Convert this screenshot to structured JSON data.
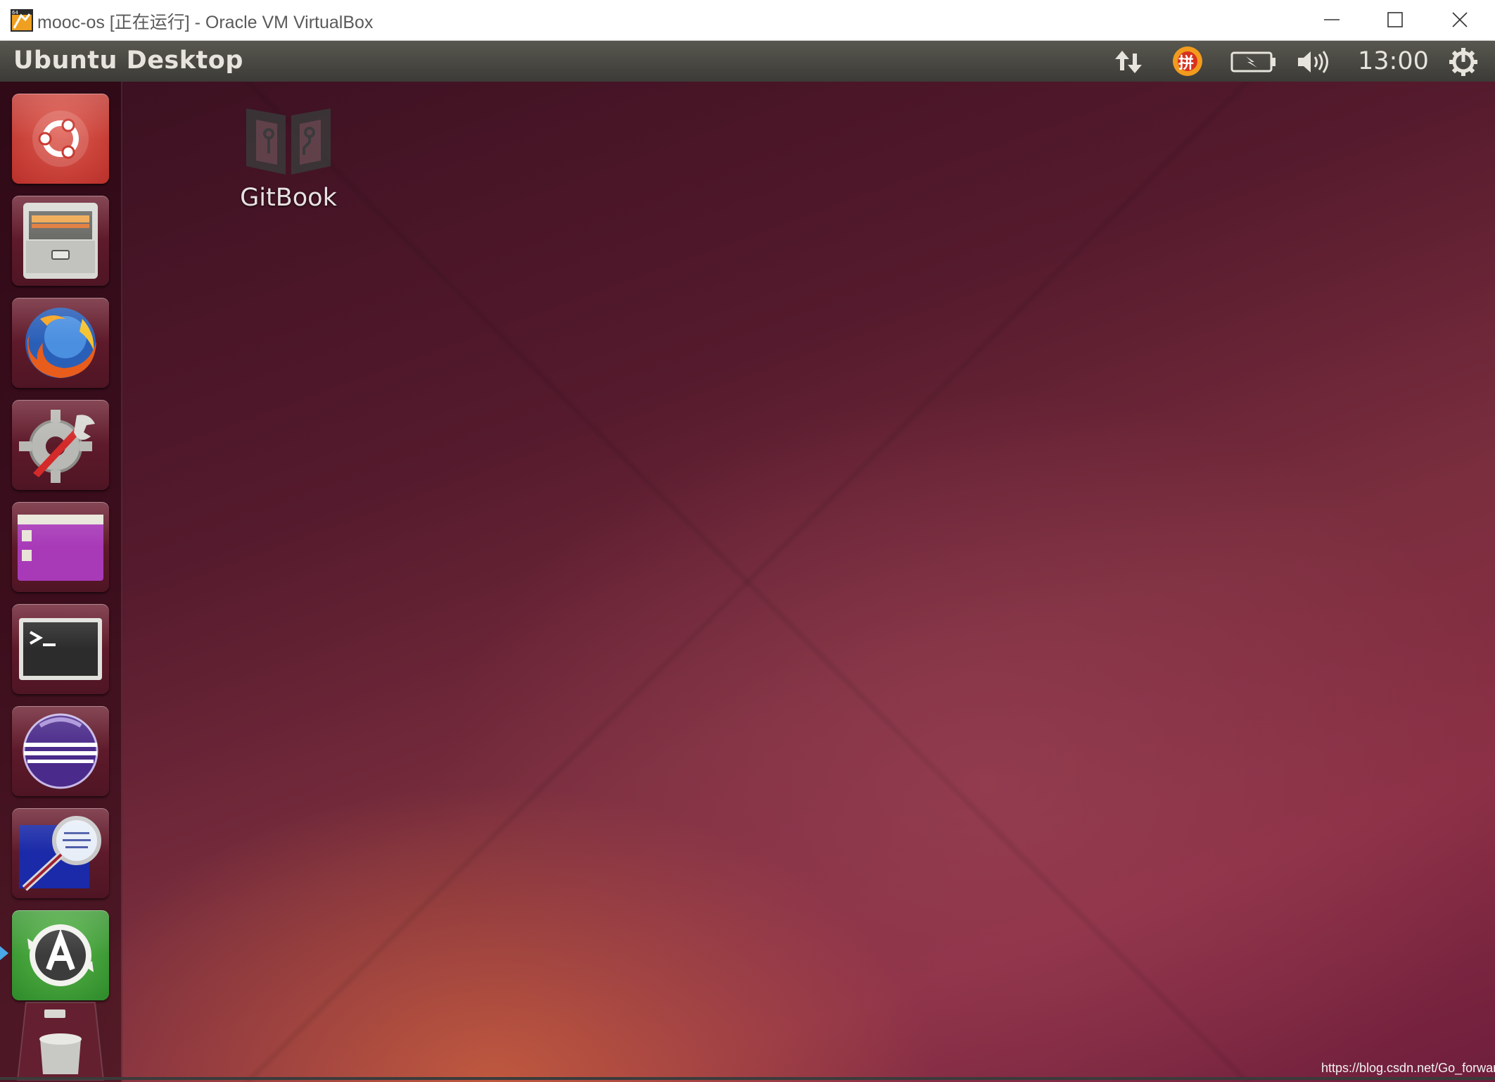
{
  "host_window": {
    "title": "mooc-os [正在运行] - Oracle VM VirtualBox",
    "controls": [
      "minimize",
      "maximize",
      "close"
    ]
  },
  "top_panel": {
    "title": "Ubuntu Desktop",
    "indicators": [
      "network-updown-icon",
      "input-method-pinyin-icon",
      "battery-icon",
      "volume-icon"
    ],
    "input_method_label": "拼",
    "clock": "13:00",
    "session_icon": "power-gear-icon"
  },
  "desktop": {
    "icons": [
      {
        "label": "GitBook",
        "icon": "gitbook-icon"
      }
    ]
  },
  "launcher": {
    "items": [
      {
        "name": "dash-home",
        "icon": "ubuntu-logo-icon",
        "color": "#c8443c"
      },
      {
        "name": "files",
        "icon": "file-cabinet-icon",
        "color": "#8a8a86"
      },
      {
        "name": "firefox",
        "icon": "firefox-icon",
        "color": "#7a2a3a"
      },
      {
        "name": "system-settings",
        "icon": "gear-wrench-icon",
        "color": "#7a2a3a"
      },
      {
        "name": "workspace-switcher",
        "icon": "workspace-icon",
        "color": "#9a3aa8"
      },
      {
        "name": "terminal",
        "icon": "terminal-icon",
        "color": "#6e2434"
      },
      {
        "name": "eclipse",
        "icon": "eclipse-icon",
        "color": "#6e2434"
      },
      {
        "name": "document-viewer",
        "icon": "magnifier-icon",
        "color": "#6e2434"
      },
      {
        "name": "software-updater",
        "icon": "software-updater-icon",
        "color": "#3f9a3a"
      },
      {
        "name": "trash",
        "icon": "trash-icon",
        "color": "#6e2434"
      }
    ],
    "active_indicator_color": "#4aa8e8"
  },
  "watermark": "https://blog.csdn.net/Go_forward_"
}
